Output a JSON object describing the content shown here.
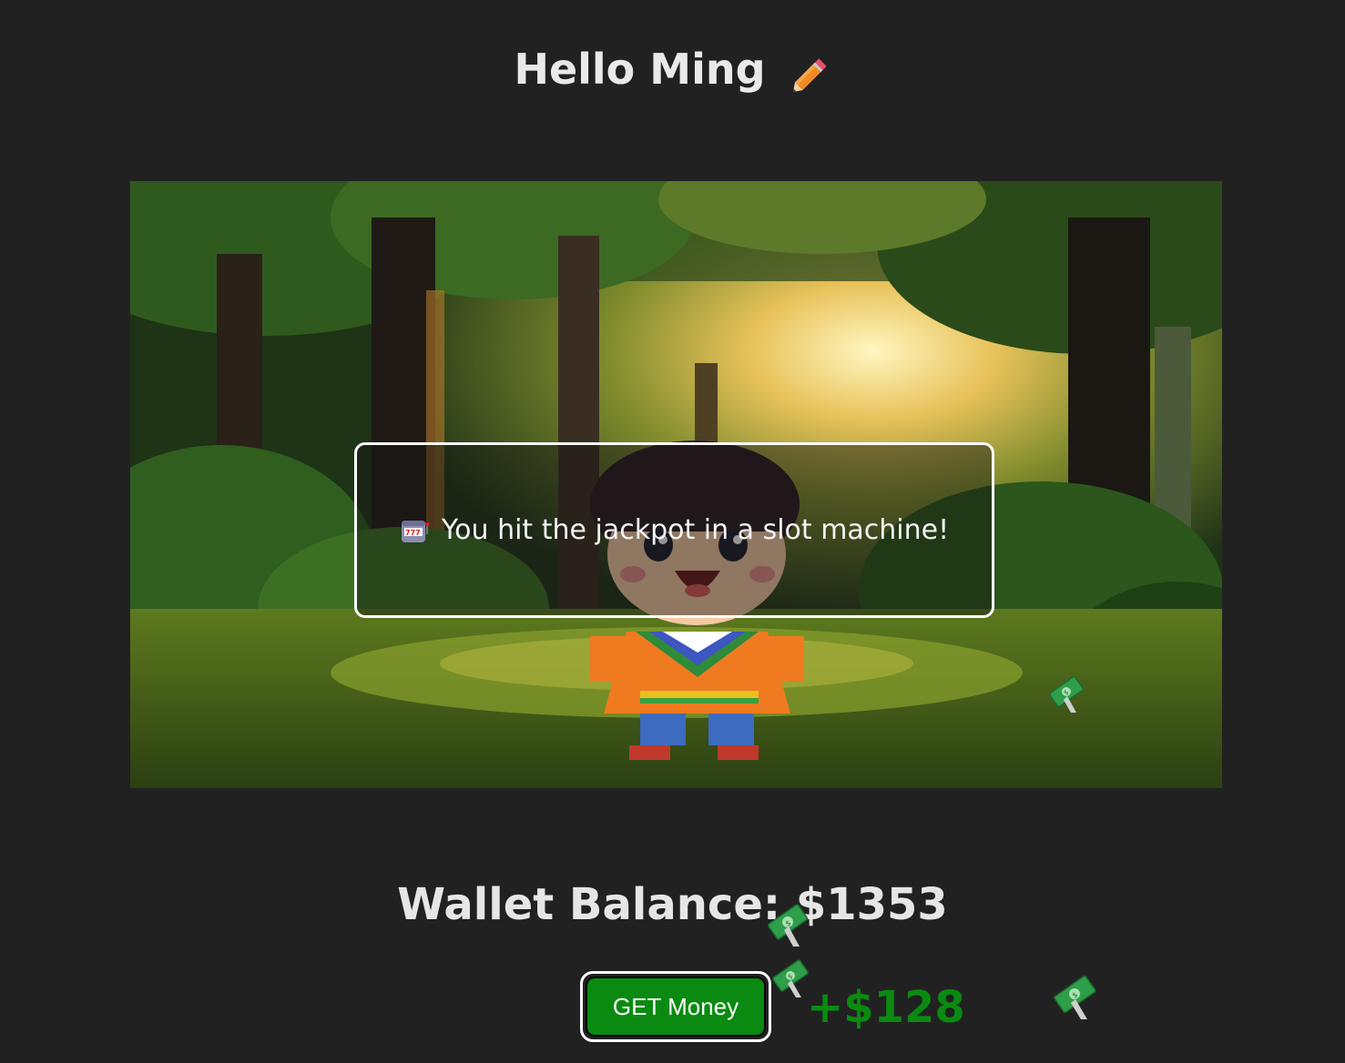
{
  "header": {
    "greeting": "Hello Ming",
    "edit_icon": "pencil-icon"
  },
  "scene": {
    "background": "pixel-art-forest",
    "character": "pixel-art-boy"
  },
  "event": {
    "icon": "slot-machine-icon",
    "message": "You hit the jackpot in a slot machine!"
  },
  "wallet": {
    "label": "Wallet Balance: $1353",
    "balance": 1353,
    "currency": "$"
  },
  "actions": {
    "get_money_label": "GET Money"
  },
  "reward": {
    "gain_text": "+$128",
    "gain_amount": 128,
    "money_icon": "money-with-wings-icon"
  },
  "colors": {
    "background": "#212121",
    "accent_green": "#0a8a10",
    "text": "#e6e6e6"
  }
}
